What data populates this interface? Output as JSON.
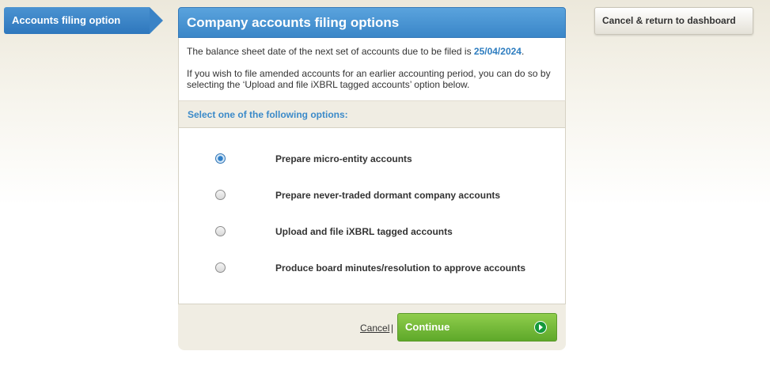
{
  "step_tab": {
    "label": "Accounts filing option"
  },
  "panel": {
    "title": "Company accounts filing options",
    "intro_prefix": "The balance sheet date of the next set of accounts due to be filed is ",
    "due_date": "25/04/2024",
    "intro_suffix": ".",
    "amend_text": "If you wish to file amended accounts for an earlier accounting period, you can do so by selecting the ‘Upload and file iXBRL tagged accounts’ option below.",
    "select_prompt": "Select one of the following options:",
    "options": [
      {
        "label": "Prepare micro-entity accounts",
        "checked": true
      },
      {
        "label": "Prepare never-traded dormant company accounts",
        "checked": false
      },
      {
        "label": "Upload and file iXBRL tagged accounts",
        "checked": false
      },
      {
        "label": "Produce board minutes/resolution to approve accounts",
        "checked": false
      }
    ]
  },
  "footer": {
    "cancel_label": "Cancel",
    "separator": "|",
    "continue_label": "Continue"
  },
  "top_right": {
    "dashboard_label": "Cancel & return to dashboard"
  },
  "colors": {
    "accent_blue": "#3a86c8",
    "date_blue": "#2e7dc0",
    "continue_green": "#6cb534"
  },
  "icons": {
    "continue": "arrow-right-circle-icon"
  }
}
